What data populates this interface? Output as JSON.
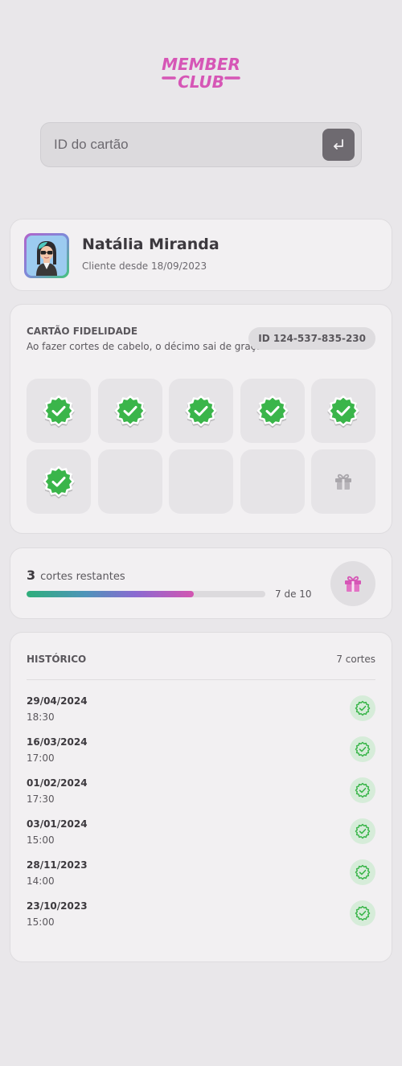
{
  "logo": {
    "line1": "MEMBER",
    "line2": "CLUB"
  },
  "search": {
    "placeholder": "ID do cartão",
    "value": ""
  },
  "profile": {
    "name": "Natália Miranda",
    "since": "Cliente desde 18/09/2023"
  },
  "loyalty": {
    "title": "CARTÃO FIDELIDADE",
    "description": "Ao fazer cortes de cabelo, o décimo sai de graça!",
    "card_id": "ID 124-537-835-230",
    "slots": [
      {
        "state": "checked",
        "icon": "badge-check-icon"
      },
      {
        "state": "checked",
        "icon": "badge-check-icon"
      },
      {
        "state": "checked",
        "icon": "badge-check-icon"
      },
      {
        "state": "checked",
        "icon": "badge-check-icon"
      },
      {
        "state": "checked",
        "icon": "badge-check-icon"
      },
      {
        "state": "checked",
        "icon": "badge-check-icon"
      },
      {
        "state": "empty"
      },
      {
        "state": "empty"
      },
      {
        "state": "empty"
      },
      {
        "state": "gift",
        "icon": "gift-icon"
      }
    ]
  },
  "progress": {
    "remaining": "3",
    "remaining_label": "cortes restantes",
    "progress_text": "7 de 10",
    "fraction": 0.7
  },
  "history": {
    "title": "HISTÓRICO",
    "count": "7 cortes",
    "items": [
      {
        "date": "29/04/2024",
        "time": "18:30"
      },
      {
        "date": "16/03/2024",
        "time": "17:00"
      },
      {
        "date": "01/02/2024",
        "time": "17:30"
      },
      {
        "date": "03/01/2024",
        "time": "15:00"
      },
      {
        "date": "28/11/2023",
        "time": "14:00"
      },
      {
        "date": "23/10/2023",
        "time": "15:00"
      }
    ]
  },
  "colors": {
    "brand": "#d656b6",
    "check_green": "#3ab54a",
    "background": "#e9e7ea",
    "card": "#f2f0f2"
  }
}
